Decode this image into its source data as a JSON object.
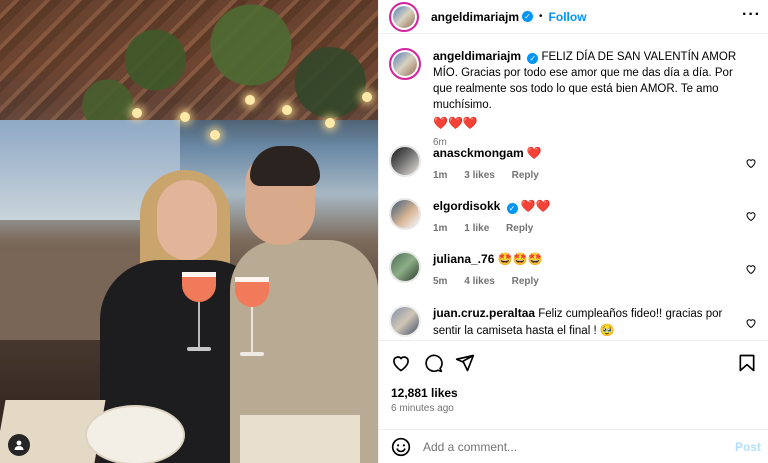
{
  "post": {
    "username": "angeldimariajm",
    "follow_label": "Follow",
    "menu_icon": "more-icon",
    "caption": {
      "username": "angeldimariajm",
      "text": "FELIZ DÍA DE SAN VALENTÍN AMOR MÍO. Gracias por todo ese amor que me das día a día. Por que realmente sos todo lo que está bien AMOR. Te amo muchísimo.",
      "emoji": "❤️❤️❤️",
      "time": "6m"
    },
    "comments": [
      {
        "username": "anasckmongam",
        "text": "",
        "emoji": "❤️",
        "time": "1m",
        "likes": "3 likes",
        "reply": "Reply",
        "verified": false
      },
      {
        "username": "elgordisokk",
        "text": "",
        "emoji": "❤️❤️",
        "time": "1m",
        "likes": "1 like",
        "reply": "Reply",
        "verified": true
      },
      {
        "username": "juliana_.76",
        "text": "",
        "emoji": "🤩🤩🤩",
        "time": "5m",
        "likes": "4 likes",
        "reply": "Reply",
        "verified": false
      },
      {
        "username": "juan.cruz.peraltaa",
        "text": "Feliz cumpleaños fideo!! gracias por sentir la camiseta hasta el final !",
        "emoji": "🥹",
        "time": "",
        "likes": "",
        "reply": "",
        "verified": false
      }
    ],
    "likes": "12,881 likes",
    "posted_ago": "6 minutes ago",
    "add_comment_placeholder": "Add a comment...",
    "post_label": "Post"
  },
  "colors": {
    "accent": "#0095f6",
    "muted": "#737373",
    "heart": "#e0245e"
  }
}
